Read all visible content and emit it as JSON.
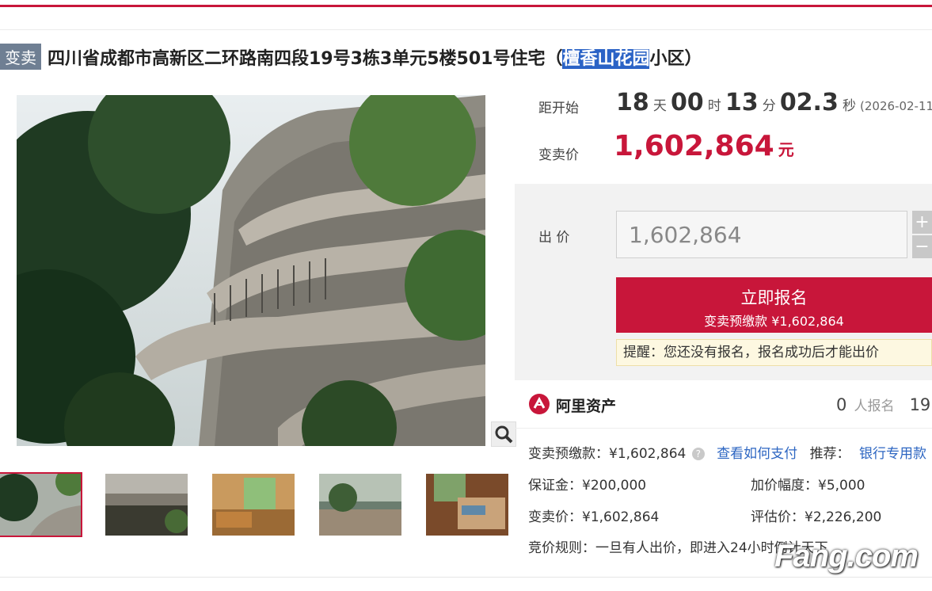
{
  "title": {
    "tag": "变卖",
    "main": "四川省成都市高新区二环路南四段19号3栋3单元5楼501号住宅（",
    "highlight": "檀香山花园",
    "tail": "小区）"
  },
  "countdown": {
    "label": "距开始",
    "days": "18",
    "days_unit": "天",
    "hours": "00",
    "hours_unit": "时",
    "minutes": "13",
    "minutes_unit": "分",
    "seconds": "02.3",
    "seconds_unit": "秒",
    "date": "(2026-02-11"
  },
  "price": {
    "label": "变卖价",
    "value": "1,602,864",
    "unit": "元"
  },
  "bid": {
    "label": "出 价",
    "input_value": "1,602,864",
    "plus": "+",
    "minus": "−",
    "apply_label": "立即报名",
    "apply_sub": "变卖预缴款 ¥1,602,864",
    "notice": "提醒：您还没有报名，报名成功后才能出价"
  },
  "platform": {
    "name": "阿里资产",
    "applicants_count": "0",
    "applicants_label": "人报名",
    "views": "19"
  },
  "details": {
    "deposit_label": "变卖预缴款：¥1,602,864",
    "pay_link": "查看如何支付",
    "recommend_label": "推荐：",
    "recommend_link": "银行专用款",
    "bond": "保证金：¥200,000",
    "increment": "加价幅度：¥5,000",
    "sale_price": "变卖价：¥1,602,864",
    "appraisal": "评估价：¥2,226,200",
    "rule": "竞价规则：一旦有人出价，即进入24小时",
    "rule_tail": "倒计天下"
  },
  "watermark": {
    "text": "Fang.com"
  },
  "colors": {
    "accent": "#c8163a",
    "link": "#2d66c2",
    "tag_bg": "#6f7f93",
    "highlight": "#2b63c6"
  },
  "icons": {
    "zoom": "magnifier-icon",
    "help": "question-circle-icon",
    "logo": "ali-assets-logo-icon"
  }
}
